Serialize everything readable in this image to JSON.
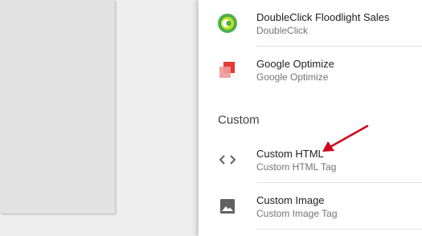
{
  "items": [
    {
      "title": "DoubleClick Floodlight Sales",
      "subtitle": "DoubleClick",
      "icon": "doubleclick-icon"
    },
    {
      "title": "Google Optimize",
      "subtitle": "Google Optimize",
      "icon": "google-optimize-icon"
    }
  ],
  "custom_section": {
    "heading": "Custom",
    "items": [
      {
        "title": "Custom HTML",
        "subtitle": "Custom HTML Tag",
        "icon": "code-icon"
      },
      {
        "title": "Custom Image",
        "subtitle": "Custom Image Tag",
        "icon": "image-icon"
      }
    ]
  },
  "colors": {
    "doubleclick_green": "#4caf50",
    "doubleclick_lime": "#c5e11c",
    "optimize_red": "#e53935",
    "optimize_pink": "#ef9a9a",
    "annotation_arrow": "#d0021b",
    "icon_gray": "#616161"
  }
}
